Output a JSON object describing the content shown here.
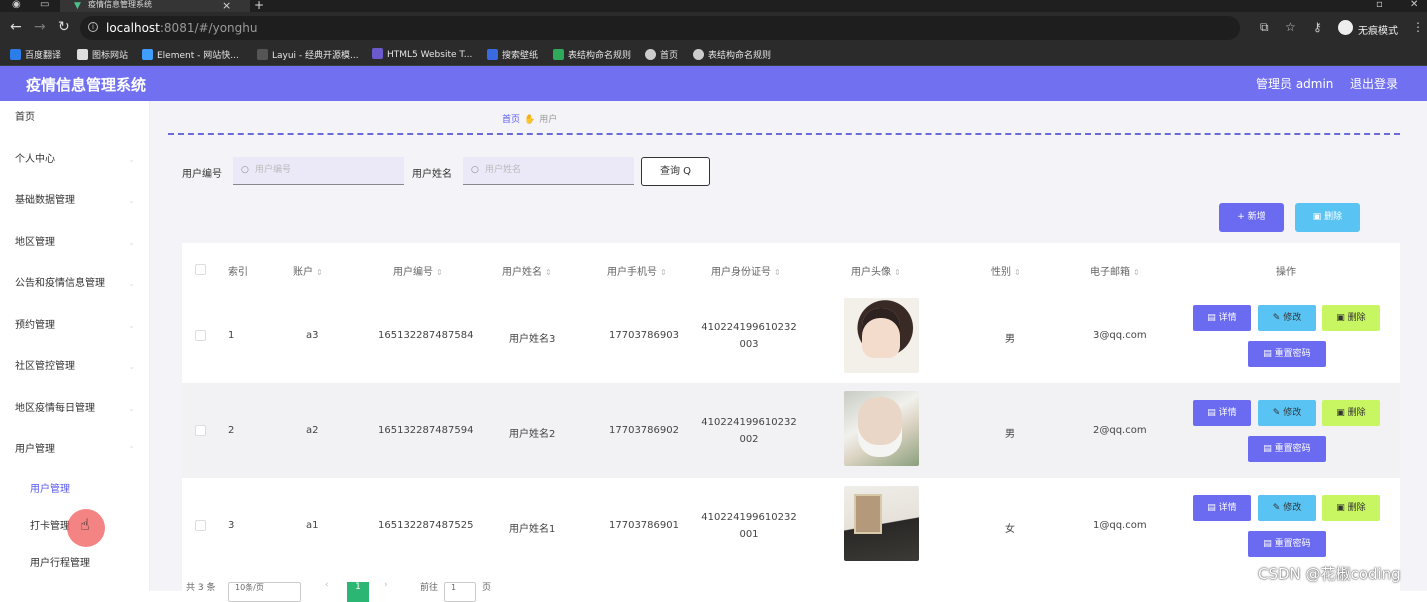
{
  "browser": {
    "tab_title": "疫情信息管理系统",
    "tab_close": "×",
    "tab_new": "+",
    "url_host": "localhost",
    "url_rest": ":8081/#/yonghu",
    "incognito": "无痕模式",
    "bookmarks": [
      "百度翻译",
      "图标网站",
      "Element - 网站快...",
      "Layui - 经典开源模...",
      "HTML5 Website T...",
      "搜索壁纸",
      "表结构命名规则",
      "首页",
      "表结构命名规则"
    ]
  },
  "header": {
    "title": "疫情信息管理系统",
    "admin": "管理员 admin",
    "logout": "退出登录"
  },
  "sidebar": {
    "items": [
      "首页",
      "个人中心",
      "基础数据管理",
      "地区管理",
      "公告和疫情信息管理",
      "预约管理",
      "社区管控管理",
      "地区疫情每日管理",
      "用户管理"
    ],
    "sub_items": [
      "用户管理",
      "打卡管理",
      "用户行程管理"
    ]
  },
  "breadcrumb": {
    "home": "首页",
    "current": "用户"
  },
  "filters": {
    "user_no_label": "用户编号",
    "user_no_placeholder": "用户编号",
    "user_name_label": "用户姓名",
    "user_name_placeholder": "用户姓名",
    "query_btn": "查询 Q"
  },
  "actions": {
    "add": "+ 新增",
    "batch_delete": "删除"
  },
  "table": {
    "headers": [
      "索引",
      "账户",
      "用户编号",
      "用户姓名",
      "用户手机号",
      "用户身份证号",
      "用户头像",
      "性别",
      "电子邮箱",
      "操作"
    ],
    "rows": [
      {
        "index": "1",
        "account": "a3",
        "no": "165132287487584",
        "name": "用户姓名3",
        "phone": "17703786903",
        "id_l1": "410224199610232",
        "id_l2": "003",
        "gender": "男",
        "email": "3@qq.com"
      },
      {
        "index": "2",
        "account": "a2",
        "no": "165132287487594",
        "name": "用户姓名2",
        "phone": "17703786902",
        "id_l1": "410224199610232",
        "id_l2": "002",
        "gender": "男",
        "email": "2@qq.com"
      },
      {
        "index": "3",
        "account": "a1",
        "no": "165132287487525",
        "name": "用户姓名1",
        "phone": "17703786901",
        "id_l1": "410224199610232",
        "id_l2": "001",
        "gender": "女",
        "email": "1@qq.com"
      }
    ],
    "btn_detail": "详情",
    "btn_edit": "修改",
    "btn_delete": "删除",
    "btn_reset": "重置密码"
  },
  "pager": {
    "total": "共 3 条",
    "page_size": "10条/页",
    "current": "1",
    "goto": "前往",
    "page_unit": "页",
    "goto_value": "1"
  },
  "watermark": "CSDN @花椒coding",
  "colors": {
    "primary": "#7070f0",
    "info": "#59c4f4",
    "warning": "#c8f562",
    "success": "#2bb673"
  }
}
